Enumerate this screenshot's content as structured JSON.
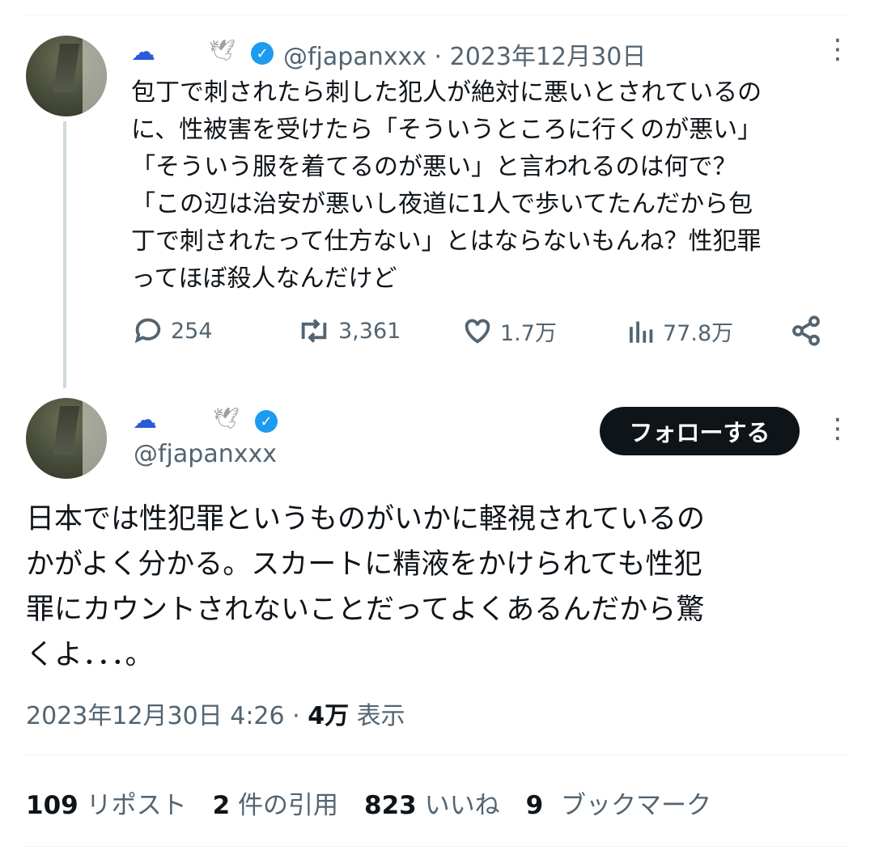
{
  "reply_tweet": {
    "name_icon": "cloud-icon",
    "dove_icon": "dove-icon",
    "handle": "@fjapanxxx",
    "separator": "·",
    "date": "2023年12月30日",
    "text": "包丁で刺されたら刺した犯人が絶対に悪いとされているの\nに、性被害を受けたら「そういうところに行くのが悪い」\n「そういう服を着てるのが悪い」と言われるのは何で？\n「この辺は治安が悪いし夜道に1人で歩いてたんだから包\n丁で刺されたって仕方ない」とはならないもんね？性犯罪\nってほぼ殺人なんだけど",
    "actions": {
      "replies": "254",
      "reposts": "3,361",
      "likes": "1.7万",
      "views": "77.8万"
    }
  },
  "main_tweet": {
    "handle": "@fjapanxxx",
    "follow_label": "フォローする",
    "text": "日本では性犯罪というものがいかに軽視されているの\nかがよく分かる。スカートに精液をかけられても性犯\n罪にカウントされないことだってよくあるんだから驚\nくよ．．．。",
    "timestamp": "2023年12月30日 4:26",
    "timestamp_sep": " · ",
    "views_count": "4万",
    "views_label": " 表示",
    "stats": [
      {
        "num": "109",
        "label": " リポスト"
      },
      {
        "num": "2",
        "label": " 件の引用"
      },
      {
        "num": "823",
        "label": " いいね"
      },
      {
        "num": "9",
        "label": " ブックマーク"
      }
    ]
  },
  "colors": {
    "text": "#0f1419",
    "secondary": "#536471",
    "verified": "#1d9bf0",
    "cloud": "#2a5bd7",
    "divider": "#eff3f4",
    "button_bg": "#0f1419"
  }
}
